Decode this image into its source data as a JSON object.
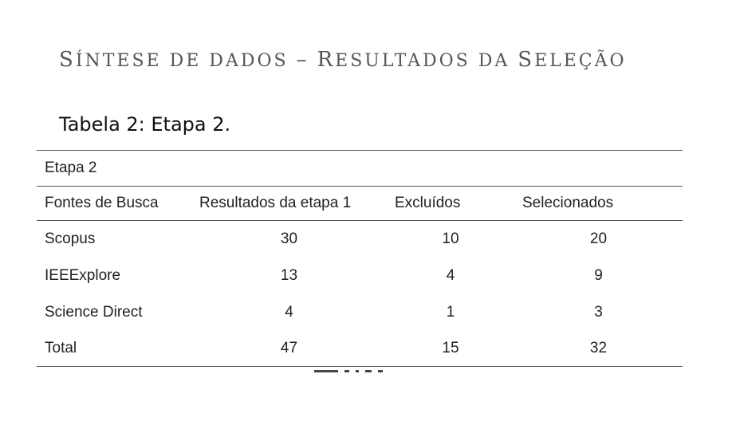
{
  "slide": {
    "title_first_letter": "S",
    "title_rest": "ÍNTESE DE DADOS ",
    "title_dash": "–",
    "title_space": " ",
    "title_r": "R",
    "title_esultados": "ESULTADOS DA ",
    "title_s": "S",
    "title_elecao": "ELEÇÃO"
  },
  "caption": "Tabela 2: Etapa 2.",
  "table": {
    "stage_label": "Etapa 2",
    "headers": [
      "Fontes de Busca",
      "Resultados da etapa 1",
      "Excluídos",
      "Selecionados"
    ],
    "rows": [
      [
        "Scopus",
        "30",
        "10",
        "20"
      ],
      [
        "IEEExplore",
        "13",
        "4",
        "9"
      ],
      [
        "Science Direct",
        "4",
        "1",
        "3"
      ],
      [
        "Total",
        "47",
        "15",
        "32"
      ]
    ]
  }
}
